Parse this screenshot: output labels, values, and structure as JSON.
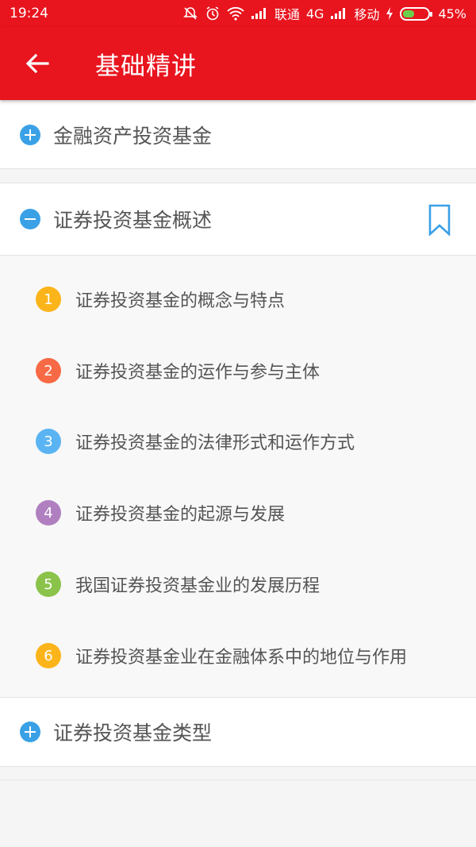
{
  "status_bar": {
    "time": "19:24",
    "carrier1": "联通",
    "network": "4G",
    "carrier2": "移动",
    "battery": "45%",
    "battery_level": 0.45,
    "icons": [
      "mute-icon",
      "alarm-icon",
      "wifi-icon",
      "signal-icon",
      "signal-icon",
      "charging-icon",
      "battery-icon"
    ]
  },
  "app_bar": {
    "title": "基础精讲",
    "back_icon": "arrow-left-icon",
    "color": "#e8141e"
  },
  "sections": [
    {
      "label": "金融资产投资基金",
      "expanded": false
    },
    {
      "label": "证券投资基金概述",
      "expanded": true
    },
    {
      "label": "证券投资基金类型",
      "expanded": false
    }
  ],
  "sub_items": [
    {
      "number": "1",
      "label": "证券投资基金的概念与特点",
      "color": "#fbb41a"
    },
    {
      "number": "2",
      "label": "证券投资基金的运作与参与主体",
      "color": "#f76a45"
    },
    {
      "number": "3",
      "label": "证券投资基金的法律形式和运作方式",
      "color": "#5ab4f3"
    },
    {
      "number": "4",
      "label": "证券投资基金的起源与发展",
      "color": "#b07fc0"
    },
    {
      "number": "5",
      "label": "我国证券投资基金业的发展历程",
      "color": "#8bc34a"
    },
    {
      "number": "6",
      "label": "证券投资基金业在金融体系中的地位与作用",
      "color": "#fbb41a"
    }
  ],
  "accent_color": "#3aa1e6"
}
